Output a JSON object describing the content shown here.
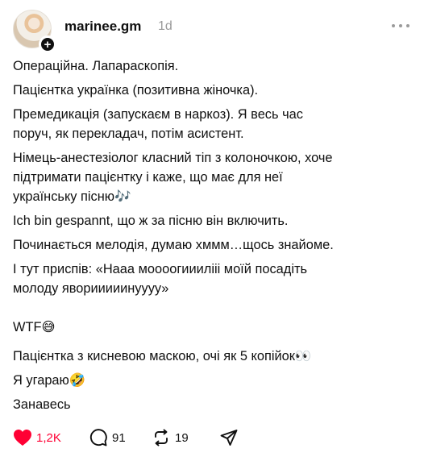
{
  "post": {
    "username": "marinee.gm",
    "timestamp": "1d",
    "lines": [
      "Операційна. Лапараскопія.",
      "Пацієнтка українка (позитивна жіночка).",
      "Премедикація (запускаєм в наркоз). Я весь час",
      "поруч, як перекладач, потім асистент.",
      "Німець-анестезіолог класний тіп з колоночкою, хоче",
      "підтримати пацієнтку і каже, що має для неї",
      "українську пісню🎶",
      "Ich bin gespannt, що ж за пісню він включить.",
      "Починається мелодія, думаю хммм…щось знайоме.",
      "І тут приспів: «Нааа моооогииилііі моїй посадіть",
      "молоду яворииииинуууу»",
      "WTF😅",
      "Пацієнтка з кисневою маскою, очі як 5 копійок👀",
      "Я угараю🤣",
      "Занавесь"
    ]
  },
  "actions": {
    "likes": "1,2K",
    "replies": "91",
    "reposts": "19"
  },
  "colors": {
    "like": "#ff0034",
    "text": "#101010",
    "muted": "#9a9a9a"
  }
}
